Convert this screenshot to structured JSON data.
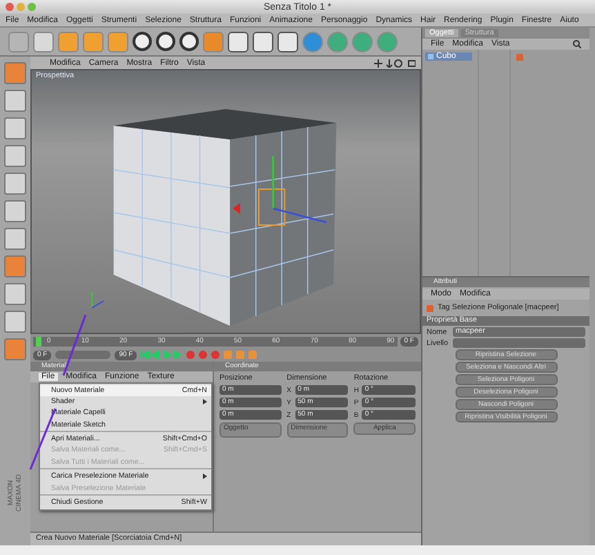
{
  "window": {
    "title": "Senza Titolo 1 *"
  },
  "menu": [
    "File",
    "Modifica",
    "Oggetti",
    "Strumenti",
    "Selezione",
    "Struttura",
    "Funzioni",
    "Animazione",
    "Personaggio",
    "Dynamics",
    "Hair",
    "Rendering",
    "Plugin",
    "Finestre",
    "Aiuto"
  ],
  "viewport": {
    "menu": [
      "Modifica",
      "Camera",
      "Mostra",
      "Filtro",
      "Vista"
    ],
    "label": "Prospettiva"
  },
  "timeline": {
    "ticks": [
      "0",
      "10",
      "20",
      "30",
      "40",
      "50",
      "60",
      "70",
      "80",
      "90"
    ],
    "frame": "0 F",
    "range": {
      "level": 1
    },
    "start": "0 F",
    "end": "90 F"
  },
  "objects": {
    "tabs": [
      {
        "label": "Oggetti",
        "selected": true
      },
      {
        "label": "Struttura",
        "selected": false
      }
    ],
    "menu": [
      "File",
      "Modifica",
      "Vista"
    ],
    "items": [
      {
        "name": "Cubo",
        "selected": true
      }
    ]
  },
  "attributes": {
    "title": "Attributi",
    "menu": [
      "Modo",
      "Modifica"
    ],
    "tag": "Tag Selezione Poligonale [macpeer]",
    "section": "Proprietà Base",
    "fields": [
      {
        "label": "Nome",
        "value": "macpeer"
      },
      {
        "label": "Livello"
      }
    ],
    "buttons": [
      "Ripristina Selezione",
      "Seleziona e Nascondi Altri",
      "Seleziona Poligoni",
      "Deseleziona Poligoni",
      "Nascondi Poligoni",
      "Ripristina Visibilità Poligoni"
    ]
  },
  "materials": {
    "title": "Materiali",
    "menu": [
      {
        "label": "File",
        "selected": true
      },
      {
        "label": "Modifica",
        "selected": false
      },
      {
        "label": "Funzione",
        "selected": false
      },
      {
        "label": "Texture",
        "selected": false
      }
    ],
    "dropdown": [
      {
        "label": "Nuovo Materiale",
        "shortcut": "Cmd+N",
        "submenu": false,
        "disabled": false,
        "selected": true,
        "separator_after": false
      },
      {
        "label": "Shader",
        "submenu": true,
        "disabled": false,
        "selected": false,
        "separator_after": false
      },
      {
        "label": "Materiale Capelli",
        "submenu": false,
        "disabled": false,
        "selected": false,
        "separator_after": false
      },
      {
        "label": "Materiale Sketch",
        "submenu": false,
        "disabled": false,
        "selected": false,
        "separator_after": true
      },
      {
        "label": "Apri Materiali...",
        "shortcut": "Shift+Cmd+O",
        "submenu": false,
        "disabled": false,
        "selected": false,
        "separator_after": false
      },
      {
        "label": "Salva Materiali come...",
        "shortcut": "Shift+Cmd+S",
        "submenu": false,
        "disabled": true,
        "selected": false,
        "separator_after": false
      },
      {
        "label": "Salva Tutti i Materiali come...",
        "submenu": false,
        "disabled": true,
        "selected": false,
        "separator_after": true
      },
      {
        "label": "Carica Preselezione Materiale",
        "submenu": true,
        "disabled": false,
        "selected": false,
        "separator_after": false
      },
      {
        "label": "Salva Preselezione Materiale",
        "submenu": false,
        "disabled": true,
        "selected": false,
        "separator_after": true
      },
      {
        "label": "Chiudi Gestione",
        "shortcut": "Shift+W",
        "submenu": false,
        "disabled": false,
        "selected": false,
        "separator_after": false
      }
    ]
  },
  "coordinates": {
    "title": "Coordinate",
    "headers": [
      "Posizione",
      "Dimensione",
      "Rotazione"
    ],
    "rows": [
      {
        "position": "0 m",
        "size_axis": "X",
        "size": "0 m",
        "rot_axis": "H",
        "rotation": "0 °"
      },
      {
        "position": "0 m",
        "size_axis": "Y",
        "size": "50 m",
        "rot_axis": "P",
        "rotation": "0 °"
      },
      {
        "position": "0 m",
        "size_axis": "Z",
        "size": "50 m",
        "rot_axis": "B",
        "rotation": "0 °"
      }
    ],
    "mode": "Oggetto",
    "size_mode": "Dimensione",
    "apply": "Applica"
  },
  "status_bar": "Crea Nuovo Materiale [Scorciatoia Cmd+N]",
  "logo": [
    "MAXON",
    "CINEMA 4D"
  ]
}
